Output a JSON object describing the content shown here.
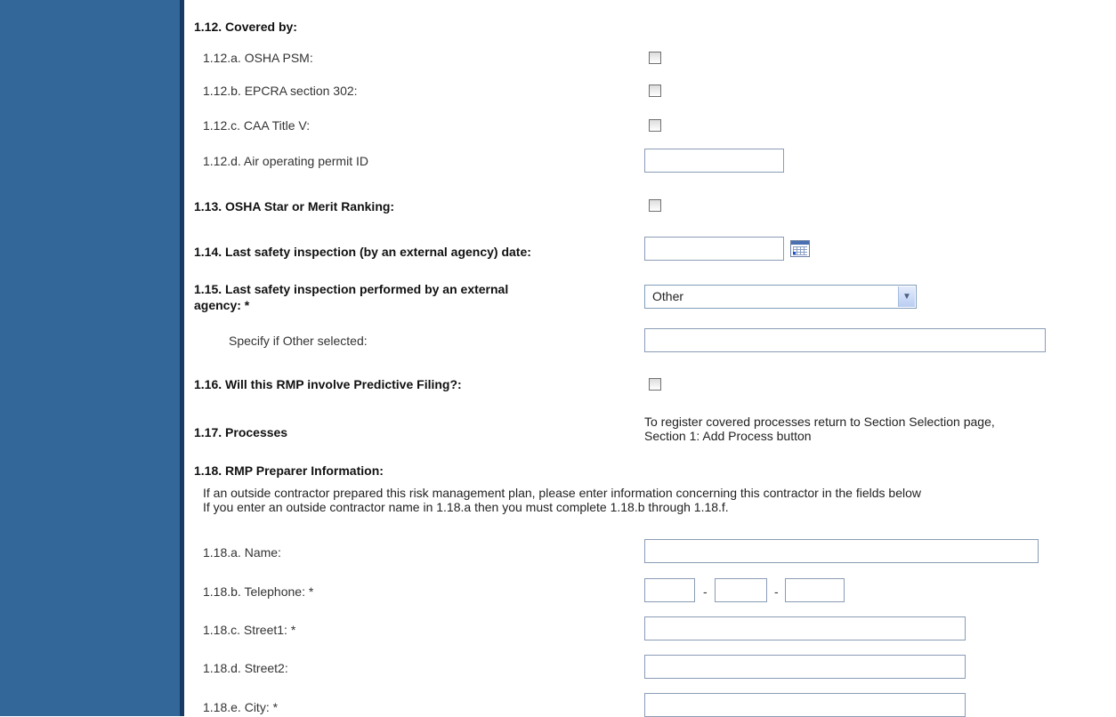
{
  "items": {
    "s1_12": "1.12. Covered by:",
    "a": "1.12.a. OSHA PSM:",
    "b": "1.12.b. EPCRA section 302:",
    "c": "1.12.c. CAA Title V:",
    "d": "1.12.d. Air operating permit ID",
    "s1_13": "1.13. OSHA Star or Merit Ranking:",
    "s1_14": "1.14. Last safety inspection (by an external agency) date:",
    "s1_15_line1": "1.15. Last safety inspection performed by an external",
    "s1_15_line2": "agency: *",
    "s1_15_value": "Other",
    "specify": "Specify if Other selected:",
    "s1_16": "1.16. Will this RMP involve Predictive Filing?:",
    "s1_17": "1.17. Processes",
    "s1_17_note1": "To register covered processes return to Section Selection page,",
    "s1_17_note2": "Section 1: Add Process button",
    "s1_18": "1.18. RMP Preparer Information:",
    "s1_18_info1": "If an outside contractor prepared this risk management plan, please enter information concerning this contractor in the fields below",
    "s1_18_info2": "If you enter an outside contractor name in 1.18.a then you must complete 1.18.b through 1.18.f.",
    "name": "1.18.a. Name:",
    "phone": "1.18.b. Telephone: *",
    "phone_sep": "-",
    "street1": "1.18.c. Street1: *",
    "street2": "1.18.d. Street2:",
    "city": "1.18.e. City: *"
  },
  "colors": {
    "sidebar": "#336699",
    "sidebar_border": "#1a3a66"
  }
}
